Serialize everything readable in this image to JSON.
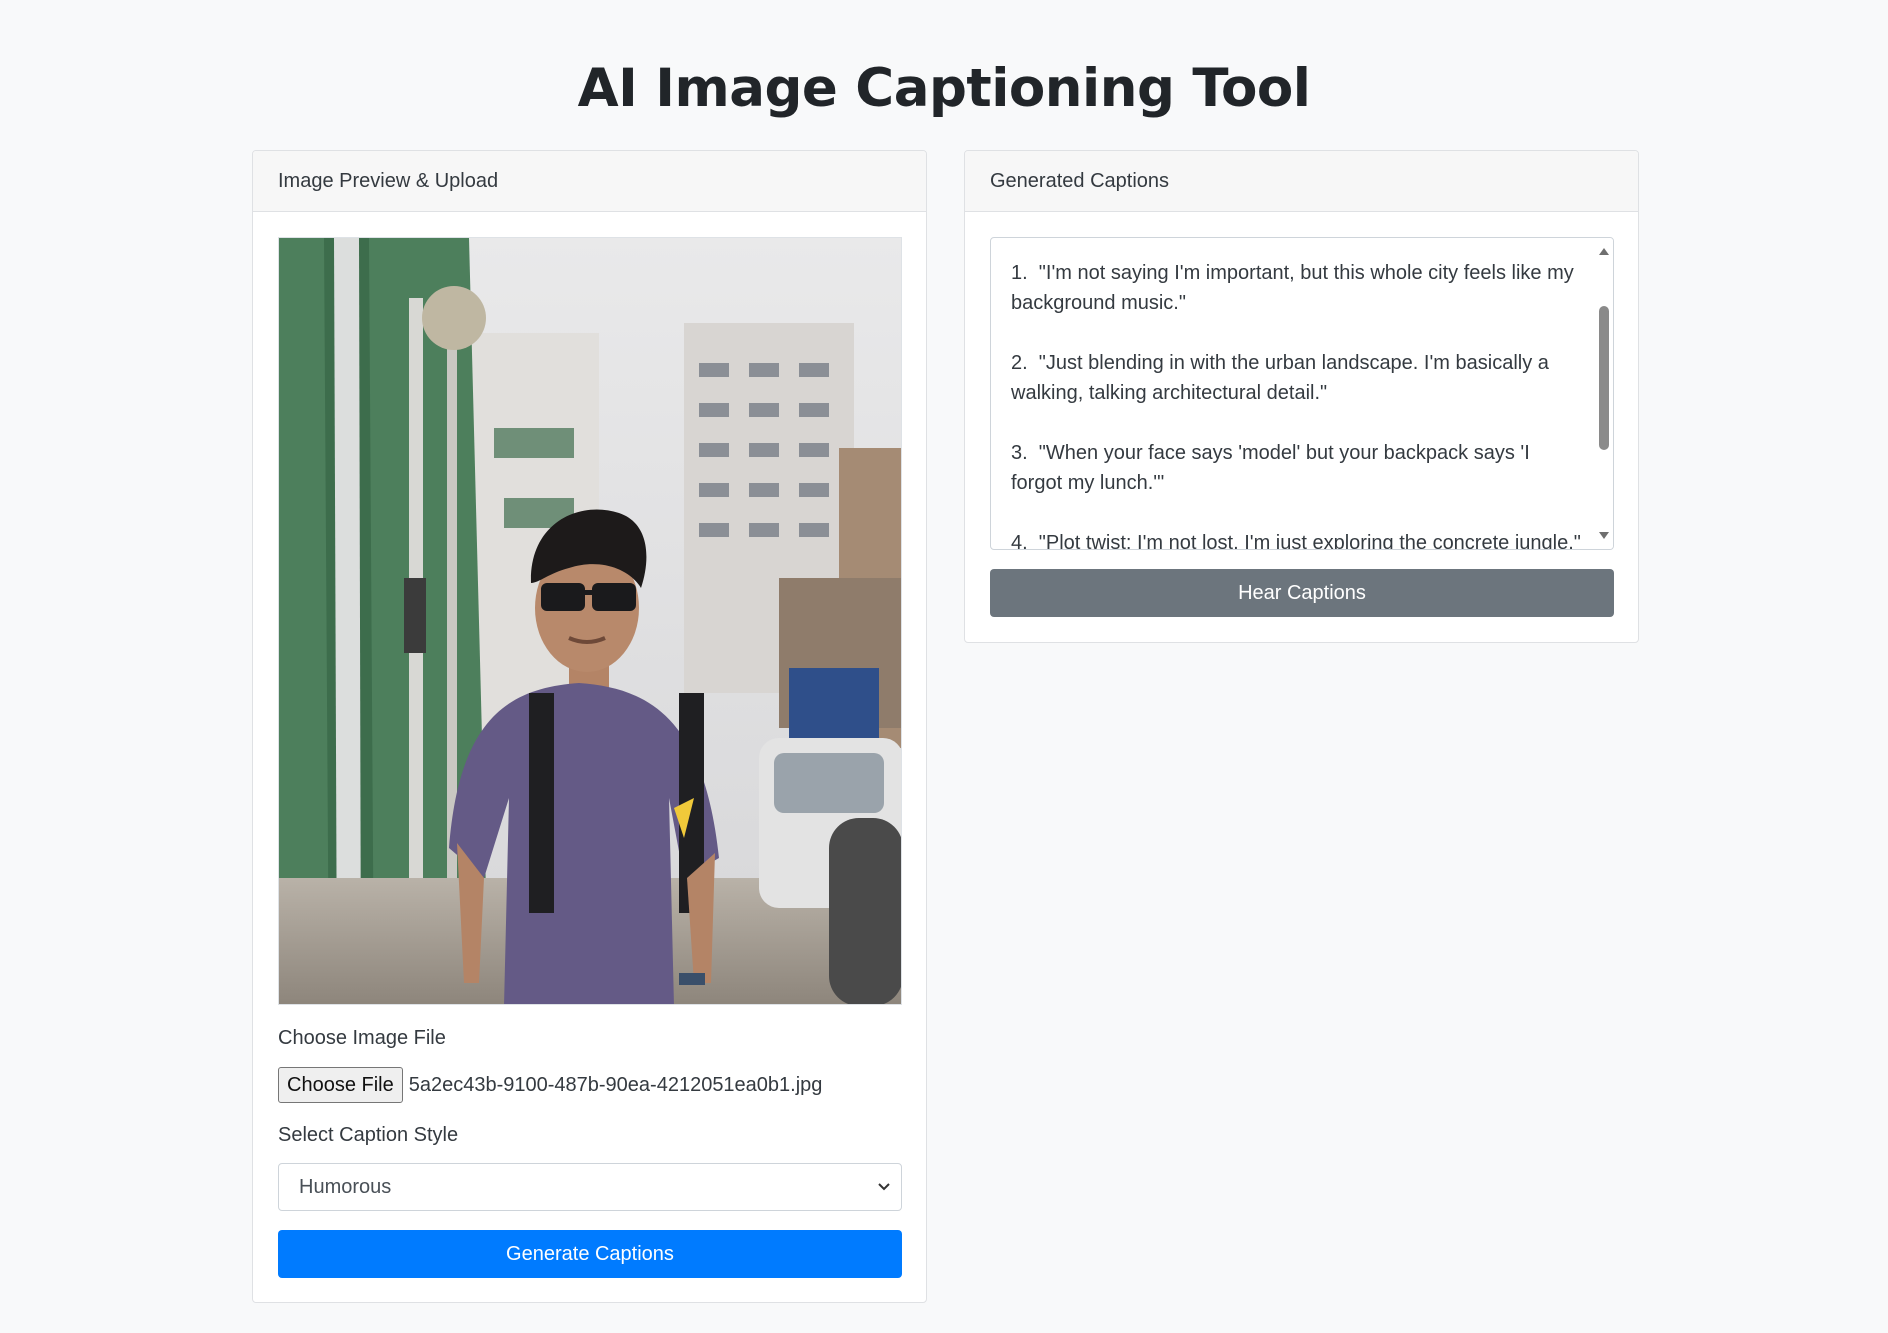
{
  "page": {
    "title": "AI Image Captioning Tool"
  },
  "upload_card": {
    "header": "Image Preview & Upload",
    "file_label": "Choose Image File",
    "file_button": "Choose File",
    "file_name": "5a2ec43b-9100-487b-90ea-4212051ea0b1.jpg",
    "style_label": "Select Caption Style",
    "style_selected": "Humorous",
    "generate_button": "Generate Captions"
  },
  "captions_card": {
    "header": "Generated Captions",
    "captions_text": "1.  \"I'm not saying I'm important, but this whole city feels like my background music.\"\n\n2.  \"Just blending in with the urban landscape. I'm basically a walking, talking architectural detail.\"\n\n3.  \"When your face says 'model' but your backpack says 'I forgot my lunch.'\"\n\n4.  \"Plot twist: I'm not lost, I'm just exploring the concrete jungle.\"",
    "hear_button": "Hear Captions"
  },
  "colors": {
    "primary": "#007bff",
    "secondary": "#6c757d",
    "background": "#f8f9fa"
  }
}
